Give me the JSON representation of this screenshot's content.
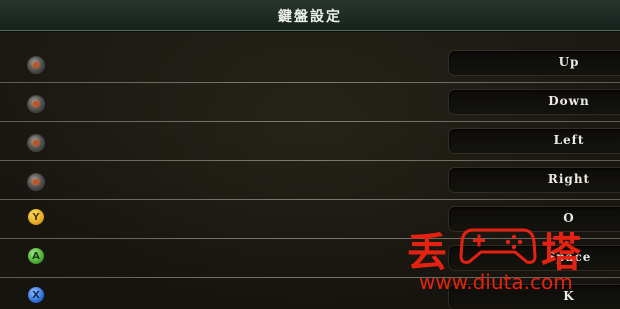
{
  "title": "鍵盤設定",
  "rows": [
    {
      "icon": "dpad-up-icon",
      "button_type": "dpad",
      "key": "Up"
    },
    {
      "icon": "dpad-down-icon",
      "button_type": "dpad",
      "key": "Down"
    },
    {
      "icon": "dpad-left-icon",
      "button_type": "dpad",
      "key": "Left"
    },
    {
      "icon": "dpad-right-icon",
      "button_type": "dpad",
      "key": "Right"
    },
    {
      "icon": "y-button-icon",
      "button_type": "face",
      "glyph": "Y",
      "color": "#e4a91f",
      "key": "O"
    },
    {
      "icon": "a-button-icon",
      "button_type": "face",
      "glyph": "A",
      "color": "#4cab32",
      "key": "Space"
    },
    {
      "icon": "x-button-icon",
      "button_type": "face",
      "glyph": "X",
      "color": "#2f6fd6",
      "key": "K"
    }
  ],
  "watermark": {
    "left_char": "丢",
    "right_char": "塔",
    "url": "www.diuta.com",
    "color": "#e52212"
  }
}
